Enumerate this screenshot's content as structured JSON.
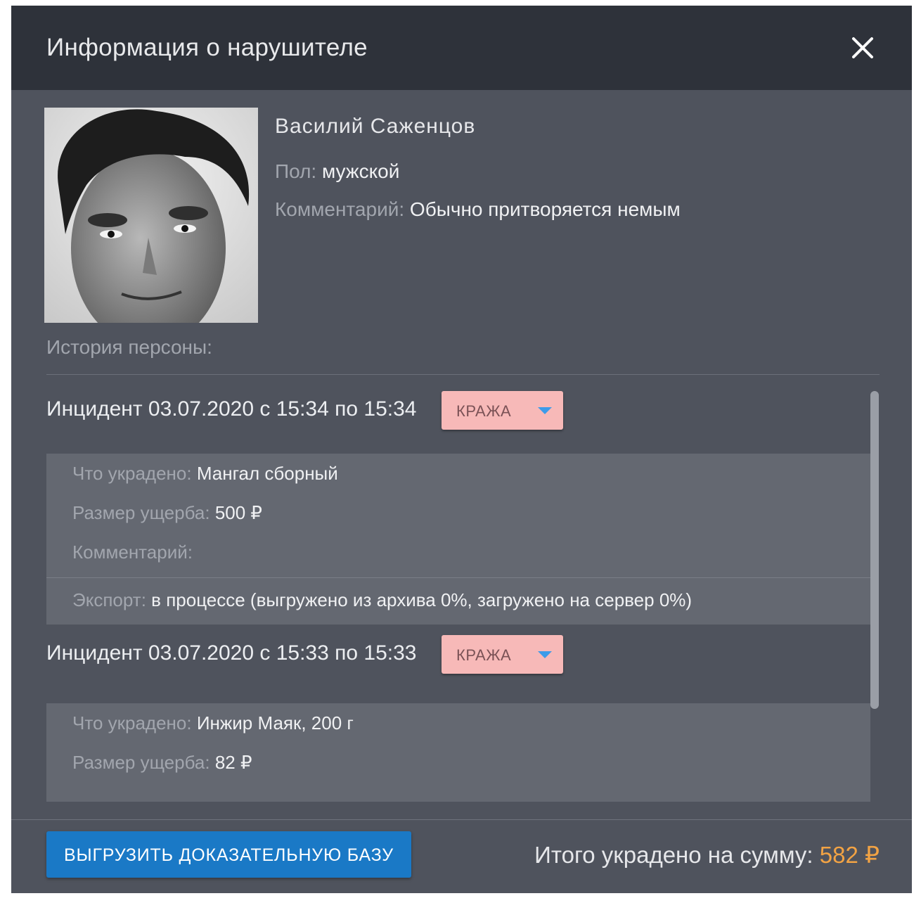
{
  "dialog": {
    "title": "Информация о нарушителе",
    "close_icon": "close-icon"
  },
  "person": {
    "photo": "portrait-photo",
    "name": "Василий Саженцов",
    "gender_label": "Пол:",
    "gender_value": "мужской",
    "comment_label": "Комментарий:",
    "comment_value": "Обычно притворяется немым"
  },
  "history": {
    "title": "История персоны:",
    "incidents": [
      {
        "title": "Инцидент 03.07.2020 с 15:34 по 15:34",
        "badge": "КРАЖА",
        "stolen_label": "Что украдено:",
        "stolen_value": "Мангал сборный",
        "damage_label": "Размер ущерба:",
        "damage_value": "500 ₽",
        "comment_label": "Комментарий:",
        "comment_value": "",
        "export_label": "Экспорт:",
        "export_value": "в процессе (выгружено из архива 0%, загружено на сервер 0%)"
      },
      {
        "title": "Инцидент 03.07.2020 с 15:33 по 15:33",
        "badge": "КРАЖА",
        "stolen_label": "Что украдено:",
        "stolen_value": "Инжир Маяк, 200 г",
        "damage_label": "Размер ущерба:",
        "damage_value": "82 ₽"
      }
    ]
  },
  "footer": {
    "export_button": "ВЫГРУЗИТЬ ДОКАЗАТЕЛЬНУЮ БАЗУ",
    "total_label": "Итого украдено на сумму:",
    "total_value": "582 ₽"
  },
  "colors": {
    "header_bg": "#2e323a",
    "dialog_bg": "#4f535d",
    "badge_bg": "#f7b9b8",
    "accent_blue": "#1a79c6",
    "total_orange": "#f2a344"
  }
}
